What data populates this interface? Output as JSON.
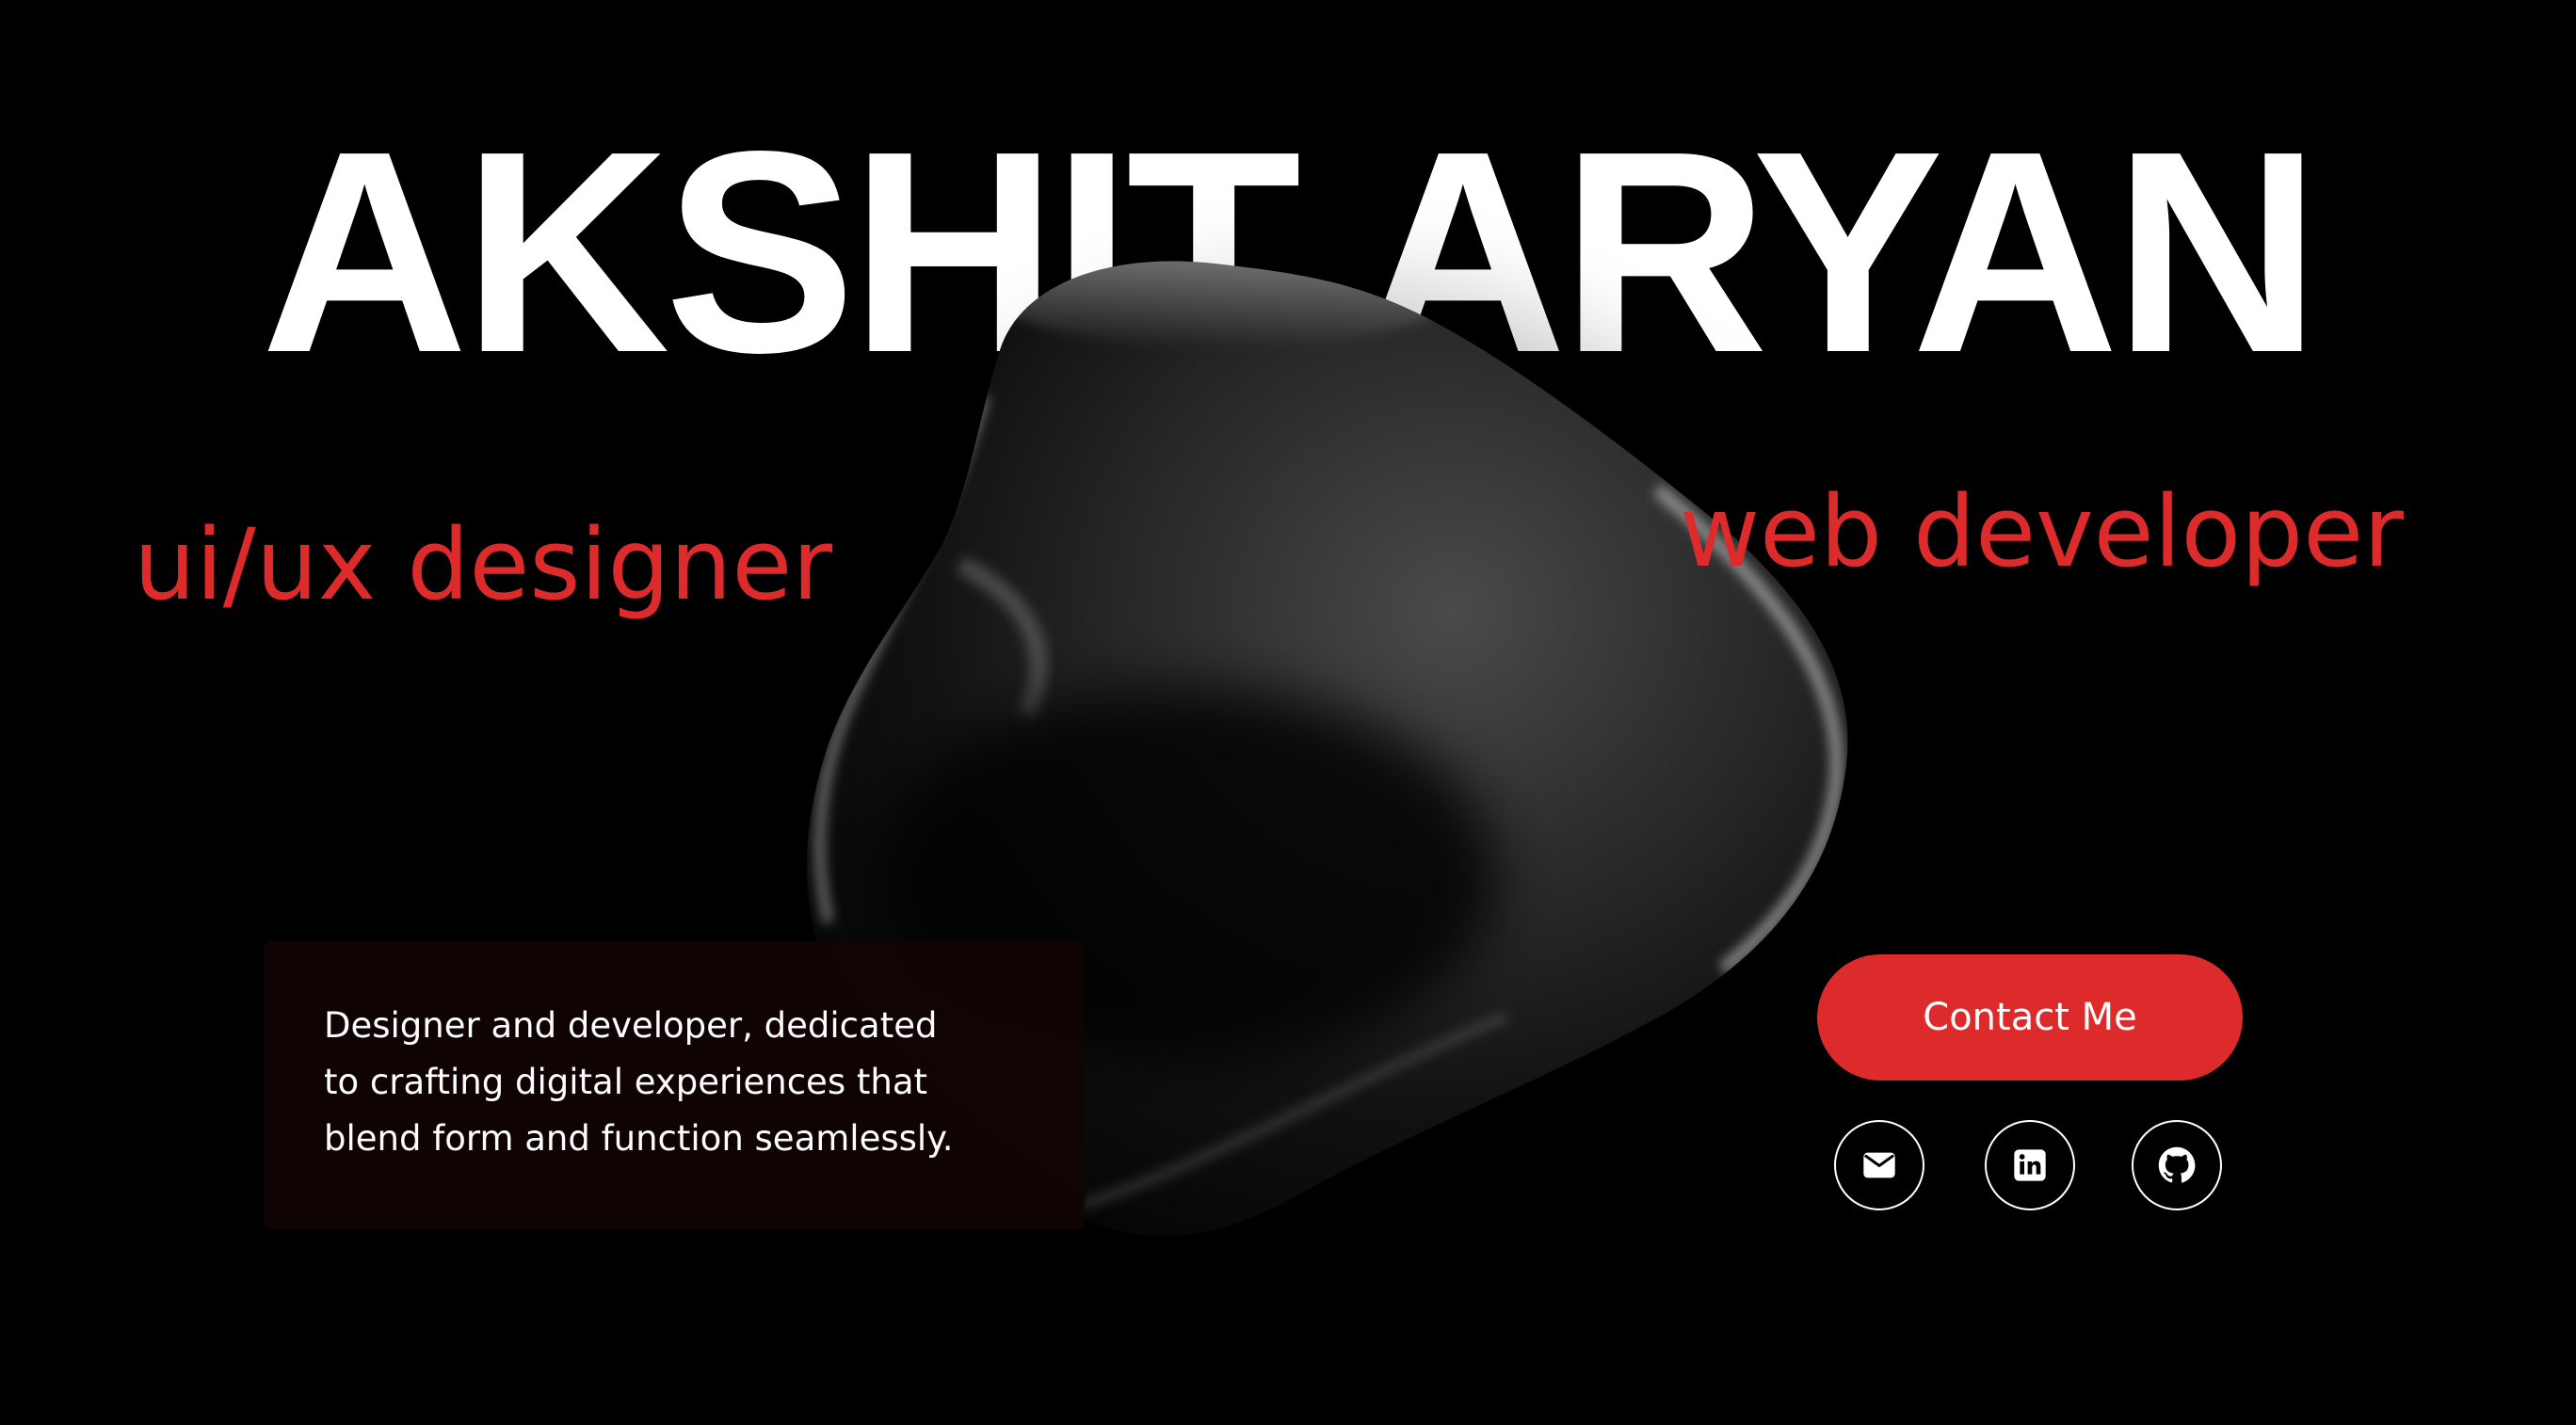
{
  "hero": {
    "name": "AKSHIT ARYAN"
  },
  "roles": {
    "left": "ui/ux designer",
    "right": "web developer"
  },
  "intro": {
    "text": "Designer and developer, dedicated\nto crafting digital experiences that\nblend form and function seamlessly."
  },
  "contact": {
    "button_label": "Contact Me"
  },
  "social": {
    "icons": [
      "mail-icon",
      "linkedin-icon",
      "github-icon"
    ]
  },
  "colors": {
    "background": "#000000",
    "accent": "#dd2b2b",
    "text": "#ffffff",
    "card": "#120404"
  }
}
